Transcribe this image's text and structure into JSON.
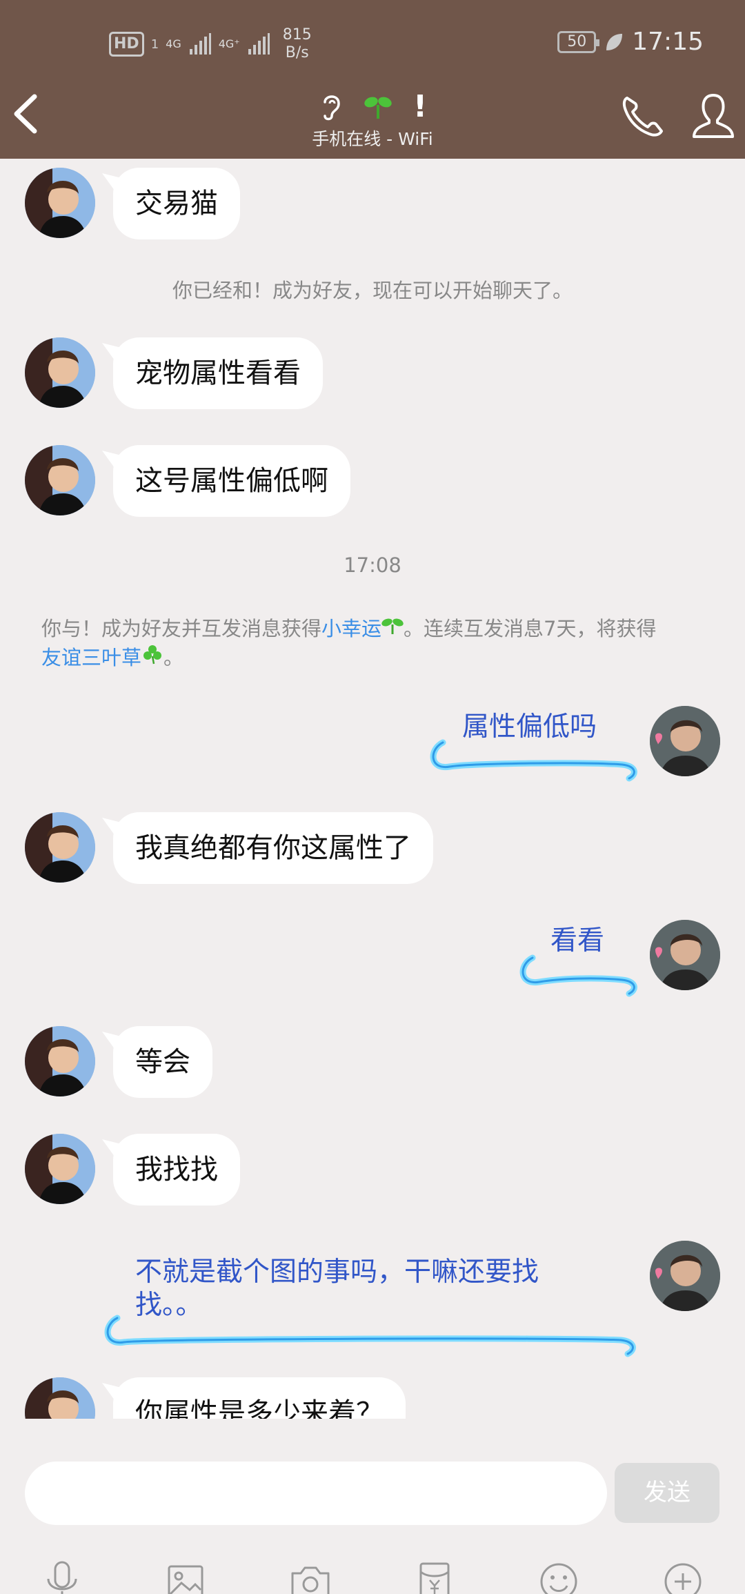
{
  "status_bar": {
    "hd": "HD",
    "sim": "1",
    "net1": "4G",
    "net2": "4G⁺",
    "speed_value": "815",
    "speed_unit": "B/s",
    "battery": "50",
    "time": "17:15"
  },
  "header": {
    "title": "!",
    "subtitle": "手机在线 - WiFi"
  },
  "messages": {
    "m1": "交易猫",
    "sys1": "你已经和！成为好友，现在可以开始聊天了。",
    "m2": "宠物属性看看",
    "m3": "这号属性偏低啊",
    "time1": "17:08",
    "notice_a": "你与！成为好友并互发消息获得",
    "notice_link1": "小幸运",
    "notice_b": "。连续互发消息7天，将获得",
    "notice_link2": "友谊三叶草",
    "notice_c": "。",
    "r1": "属性偏低吗",
    "m4": "我真绝都有你这属性了",
    "r2": "看看",
    "m5": "等会",
    "m6": "我找找",
    "r3": "不就是截个图的事吗，干嘛还要找找。。",
    "m7": "你属性是多少来着？"
  },
  "footer": {
    "send_label": "发送",
    "input_value": ""
  },
  "colors": {
    "header_bg": "#70564a",
    "chat_bg": "#f1eeee",
    "link": "#3a8ee6",
    "dragon_text": "#3156c8"
  }
}
